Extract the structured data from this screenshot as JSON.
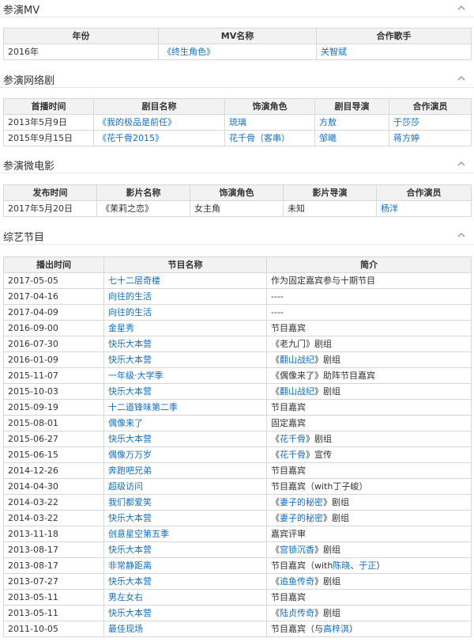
{
  "sections": {
    "mv": {
      "title": "参演MV",
      "headers": [
        "年份",
        "MV名称",
        "合作歌手"
      ],
      "rows": [
        {
          "year": "2016年",
          "name": "《终生角色》",
          "singer": "关智斌"
        }
      ]
    },
    "webdrama": {
      "title": "参演网络剧",
      "headers": [
        "首播时间",
        "剧目名称",
        "饰演角色",
        "剧目导演",
        "合作演员"
      ],
      "rows": [
        {
          "date": "2013年5月9日",
          "name": "《我的极品是前任》",
          "role": "琉璃",
          "director": "方敖",
          "costar": "于莎莎"
        },
        {
          "date": "2015年9月15日",
          "name": "《花千骨2015》",
          "role": "花千骨（客串）",
          "director": "邹曦",
          "costar": "蒋方婷"
        }
      ]
    },
    "microfilm": {
      "title": "参演微电影",
      "headers": [
        "发布时间",
        "影片名称",
        "饰演角色",
        "影片导演",
        "合作演员"
      ],
      "rows": [
        {
          "date": "2017年5月20日",
          "name": "《茉莉之恋》",
          "role": "女主角",
          "director": "未知",
          "costar": "杨洋"
        }
      ]
    },
    "variety": {
      "title": "综艺节目",
      "headers": [
        "播出时间",
        "节目名称",
        "简介"
      ],
      "rows": [
        {
          "date": "2017-05-05",
          "name": "七十二层奇楼",
          "intro": [
            {
              "t": "作为固定嘉宾参与十期节目",
              "l": false
            }
          ]
        },
        {
          "date": "2017-04-16",
          "name": "向往的生活",
          "intro": [
            {
              "t": "----",
              "l": false
            }
          ]
        },
        {
          "date": "2017-04-09",
          "name": "向往的生活",
          "intro": [
            {
              "t": "----",
              "l": false
            }
          ]
        },
        {
          "date": "2016-09-00",
          "name": "金星秀",
          "intro": [
            {
              "t": "节目嘉宾",
              "l": false
            }
          ]
        },
        {
          "date": "2016-07-30",
          "name": "快乐大本营",
          "intro": [
            {
              "t": "《老九门》剧组",
              "l": false
            }
          ]
        },
        {
          "date": "2016-01-09",
          "name": "快乐大本营",
          "intro": [
            {
              "t": "《",
              "l": false
            },
            {
              "t": "翻山战纪",
              "l": true
            },
            {
              "t": "》剧组",
              "l": false
            }
          ]
        },
        {
          "date": "2015-11-07",
          "name": "一年级·大学季",
          "intro": [
            {
              "t": "《偶像来了》助阵节目嘉宾",
              "l": false
            }
          ]
        },
        {
          "date": "2015-10-03",
          "name": "快乐大本营",
          "intro": [
            {
              "t": "《",
              "l": false
            },
            {
              "t": "翻山战纪",
              "l": true
            },
            {
              "t": "》剧组",
              "l": false
            }
          ]
        },
        {
          "date": "2015-09-19",
          "name": "十二道锋味第二季",
          "intro": [
            {
              "t": "节目嘉宾",
              "l": false
            }
          ]
        },
        {
          "date": "2015-08-01",
          "name": "偶像来了",
          "intro": [
            {
              "t": "固定嘉宾",
              "l": false
            }
          ]
        },
        {
          "date": "2015-06-27",
          "name": "快乐大本营",
          "intro": [
            {
              "t": "《",
              "l": false
            },
            {
              "t": "花千骨",
              "l": true
            },
            {
              "t": "》剧组",
              "l": false
            }
          ]
        },
        {
          "date": "2015-06-15",
          "name": "偶像万万岁",
          "intro": [
            {
              "t": "《",
              "l": false
            },
            {
              "t": "花千骨",
              "l": true
            },
            {
              "t": "》宣传",
              "l": false
            }
          ]
        },
        {
          "date": "2014-12-26",
          "name": "奔跑吧兄弟",
          "intro": [
            {
              "t": "节目嘉宾",
              "l": false
            }
          ]
        },
        {
          "date": "2014-04-30",
          "name": "超级访问",
          "intro": [
            {
              "t": "节目嘉宾（with丁子峻）",
              "l": false
            }
          ]
        },
        {
          "date": "2014-03-22",
          "name": "我们都爱笑",
          "intro": [
            {
              "t": "《",
              "l": false
            },
            {
              "t": "妻子的秘密",
              "l": true
            },
            {
              "t": "》剧组",
              "l": false
            }
          ]
        },
        {
          "date": "2014-03-22",
          "name": "快乐大本营",
          "intro": [
            {
              "t": "《",
              "l": false
            },
            {
              "t": "妻子的秘密",
              "l": true
            },
            {
              "t": "》剧组",
              "l": false
            }
          ]
        },
        {
          "date": "2013-11-18",
          "name": "创意星空第五季",
          "intro": [
            {
              "t": "嘉宾评审",
              "l": false
            }
          ]
        },
        {
          "date": "2013-08-17",
          "name": "快乐大本营",
          "intro": [
            {
              "t": "《",
              "l": false
            },
            {
              "t": "宫锁沉香",
              "l": true
            },
            {
              "t": "》剧组",
              "l": false
            }
          ]
        },
        {
          "date": "2013-08-17",
          "name": "非常静距离",
          "intro": [
            {
              "t": "节目嘉宾（with",
              "l": false
            },
            {
              "t": "陈晓",
              "l": true
            },
            {
              "t": "、",
              "l": false
            },
            {
              "t": "于正",
              "l": true
            },
            {
              "t": "）",
              "l": false
            }
          ]
        },
        {
          "date": "2013-07-27",
          "name": "快乐大本营",
          "intro": [
            {
              "t": "《",
              "l": false
            },
            {
              "t": "追鱼传奇",
              "l": true
            },
            {
              "t": "》剧组",
              "l": false
            }
          ]
        },
        {
          "date": "2013-05-11",
          "name": "男左女右",
          "intro": [
            {
              "t": "节目嘉宾",
              "l": false
            }
          ]
        },
        {
          "date": "2013-05-11",
          "name": "快乐大本营",
          "intro": [
            {
              "t": "《",
              "l": false
            },
            {
              "t": "陆贞传奇",
              "l": true
            },
            {
              "t": "》剧组",
              "l": false
            }
          ]
        },
        {
          "date": "2011-10-05",
          "name": "最佳现场",
          "intro": [
            {
              "t": "节目嘉宾（与",
              "l": false
            },
            {
              "t": "高梓淇",
              "l": true
            },
            {
              "t": "）",
              "l": false
            }
          ]
        }
      ]
    }
  },
  "colors": {
    "link": "#136ec2",
    "header_bg": "#f2f2f2",
    "border": "#d8d8d8"
  },
  "icons": {
    "collapse": "chevron-up-icon"
  }
}
